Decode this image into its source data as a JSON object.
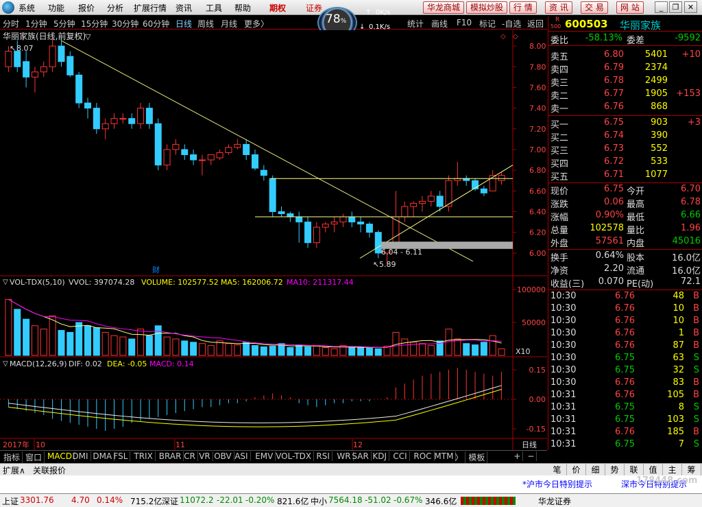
{
  "menu": {
    "items": [
      "系统",
      "功能",
      "报价",
      "分析",
      "扩展行情",
      "资讯",
      "工具",
      "帮助"
    ],
    "period_label": "期权",
    "marquee": "证券",
    "right_buttons": [
      "华龙商城",
      "模拟炒股",
      "行 情",
      "资 讯",
      "交 易",
      "网 站"
    ]
  },
  "speed": {
    "pct": "78",
    "unit": "%",
    "up": "0K/s",
    "down": "0.1K/s"
  },
  "timeframes": [
    "分时",
    "1分钟",
    "5分钟",
    "15分钟",
    "30分钟",
    "60分钟",
    "日线",
    "周线",
    "月线",
    "更多〉"
  ],
  "timeframe_selected": "日线",
  "tools": [
    "统计",
    "画线",
    "F10",
    "标记",
    "-自选",
    "返回"
  ],
  "stock": {
    "title": "华丽家族(日线,前复权)",
    "code": "600503",
    "name": "华丽家族",
    "r_badge": "R",
    "r_sub": "500"
  },
  "main_chart": {
    "high_label": "8.07",
    "low_label": "5.89",
    "range_label": "6.04 - 6.11",
    "event_label": "财",
    "price_ticks": [
      "8.00",
      "7.80",
      "7.60",
      "7.40",
      "7.20",
      "7.00",
      "6.80",
      "6.60",
      "6.40",
      "6.20",
      "6.00"
    ],
    "date_labels": [
      "2017年",
      "10",
      "11",
      "12"
    ],
    "period_label": "日线"
  },
  "vol": {
    "header": "VOL-TDX(5,10)",
    "vvol": "VVOL: 397074.28",
    "volume": "VOLUME: 102577.52",
    "ma5": "MA5: 162006.72",
    "ma10": "MA10: 211317.44",
    "ticks": [
      "100000",
      "50000"
    ],
    "unit": "X10"
  },
  "macd": {
    "header": "MACD(12,26,9)",
    "dif": "DIF: 0.02",
    "dea": "DEA: -0.05",
    "macd": "MACD: 0.14",
    "ticks": [
      "0.15",
      "0.00",
      "-0.15"
    ]
  },
  "quote": {
    "weibi_label": "委比",
    "weibi": "-58.13%",
    "weicha_label": "委差",
    "weicha": "-9592",
    "asks": [
      {
        "label": "卖五",
        "price": "6.80",
        "vol": "5401",
        "chg": "+10"
      },
      {
        "label": "卖四",
        "price": "6.79",
        "vol": "2374",
        "chg": ""
      },
      {
        "label": "卖三",
        "price": "6.78",
        "vol": "2499",
        "chg": ""
      },
      {
        "label": "卖二",
        "price": "6.77",
        "vol": "1905",
        "chg": "+153"
      },
      {
        "label": "卖一",
        "price": "6.76",
        "vol": "868",
        "chg": ""
      }
    ],
    "bids": [
      {
        "label": "买一",
        "price": "6.75",
        "vol": "903",
        "chg": "+3"
      },
      {
        "label": "买二",
        "price": "6.74",
        "vol": "390",
        "chg": ""
      },
      {
        "label": "买三",
        "price": "6.73",
        "vol": "552",
        "chg": ""
      },
      {
        "label": "买四",
        "price": "6.72",
        "vol": "533",
        "chg": ""
      },
      {
        "label": "买五",
        "price": "6.71",
        "vol": "1077",
        "chg": ""
      }
    ],
    "stats": [
      {
        "l1": "现价",
        "v1": "6.75",
        "c1": "red",
        "l2": "今开",
        "v2": "6.70",
        "c2": "red"
      },
      {
        "l1": "涨跌",
        "v1": "0.06",
        "c1": "red",
        "l2": "最高",
        "v2": "6.78",
        "c2": "red"
      },
      {
        "l1": "涨幅",
        "v1": "0.90%",
        "c1": "red",
        "l2": "最低",
        "v2": "6.66",
        "c2": "green"
      },
      {
        "l1": "总量",
        "v1": "102578",
        "c1": "yellow",
        "l2": "量比",
        "v2": "1.96",
        "c2": "red"
      },
      {
        "l1": "外盘",
        "v1": "57561",
        "c1": "red",
        "l2": "内盘",
        "v2": "45016",
        "c2": "green"
      }
    ],
    "stats2": [
      {
        "l1": "换手",
        "v1": "0.64%",
        "l2": "股本",
        "v2": "16.0亿"
      },
      {
        "l1": "净资",
        "v1": "2.20",
        "l2": "流通",
        "v2": "16.0亿"
      },
      {
        "l1": "收益(三)",
        "v1": "0.070",
        "l2": "PE(动)",
        "v2": "72.1"
      }
    ]
  },
  "ticks": [
    {
      "t": "10:30",
      "p": "6.76",
      "v": "48",
      "s": "B"
    },
    {
      "t": "10:30",
      "p": "6.76",
      "v": "10",
      "s": "B"
    },
    {
      "t": "10:30",
      "p": "6.76",
      "v": "10",
      "s": "B"
    },
    {
      "t": "10:30",
      "p": "6.76",
      "v": "1",
      "s": "B"
    },
    {
      "t": "10:30",
      "p": "6.76",
      "v": "87",
      "s": "B"
    },
    {
      "t": "10:30",
      "p": "6.75",
      "v": "63",
      "s": "S"
    },
    {
      "t": "10:30",
      "p": "6.75",
      "v": "32",
      "s": "S"
    },
    {
      "t": "10:30",
      "p": "6.76",
      "v": "83",
      "s": "B"
    },
    {
      "t": "10:31",
      "p": "6.76",
      "v": "105",
      "s": "B"
    },
    {
      "t": "10:31",
      "p": "6.75",
      "v": "8",
      "s": "S"
    },
    {
      "t": "10:31",
      "p": "6.75",
      "v": "103",
      "s": "S"
    },
    {
      "t": "10:31",
      "p": "6.76",
      "v": "185",
      "s": "B"
    },
    {
      "t": "10:31",
      "p": "6.75",
      "v": "7",
      "s": "S"
    }
  ],
  "bottom_tabs": [
    "指标",
    "窗口",
    "MACD",
    "DMI",
    "DMA",
    "FSL",
    "TRIX",
    "BRAR",
    "CR",
    "VR",
    "OBV",
    "ASI",
    "EMV",
    "VOL-TDX",
    "RSI",
    "WR",
    "SAR",
    "KDJ",
    "CCI",
    "ROC",
    "MTM",
    "〉",
    "模板",
    "+",
    "−"
  ],
  "bottom_selected": "MACD",
  "ext": {
    "ext_label": "扩展∧",
    "ref_label": "关联报价",
    "right_tabs": [
      "笔",
      "价",
      "细",
      "势",
      "联",
      "值",
      "主",
      "筹"
    ]
  },
  "news": {
    "left": "*沪市今日特别提示",
    "right": "深市今日特别提示",
    "watermark": "178448.com"
  },
  "status": {
    "sh_label": "上证",
    "sh": "3301.76",
    "sh_chg": "4.70",
    "sh_pct": "0.14%",
    "sh_amt": "715.2亿",
    "sz_label": "深证",
    "sz": "11072.2",
    "sz_chg": "-22.01",
    "sz_pct": "-0.20%",
    "sz_amt": "821.6亿",
    "zx_label": "中小",
    "zx": "7564.18",
    "zx_chg": "-51.02",
    "zx_pct": "-0.67%",
    "zx_amt": "346.6亿",
    "broker": "华龙证券"
  },
  "chart_data": [
    {
      "type": "candlestick",
      "title": "华丽家族(日线,前复权)",
      "ylim": [
        5.8,
        8.1
      ],
      "ohlc": [
        [
          7.8,
          8.0,
          7.75,
          7.95
        ],
        [
          7.95,
          8.05,
          7.75,
          7.8
        ],
        [
          7.85,
          7.95,
          7.6,
          7.7
        ],
        [
          7.7,
          7.8,
          7.55,
          7.75
        ],
        [
          7.75,
          7.85,
          7.7,
          7.8
        ],
        [
          7.8,
          8.07,
          7.75,
          8.0
        ],
        [
          8.0,
          8.07,
          7.8,
          7.85
        ],
        [
          7.9,
          7.95,
          7.7,
          7.72
        ],
        [
          7.72,
          7.75,
          7.4,
          7.45
        ],
        [
          7.45,
          7.5,
          7.3,
          7.4
        ],
        [
          7.4,
          7.45,
          7.15,
          7.2
        ],
        [
          7.2,
          7.3,
          7.1,
          7.25
        ],
        [
          7.25,
          7.35,
          7.2,
          7.3
        ],
        [
          7.3,
          7.35,
          7.25,
          7.3
        ],
        [
          7.3,
          7.35,
          7.2,
          7.25
        ],
        [
          7.25,
          7.45,
          7.2,
          7.4
        ],
        [
          7.4,
          7.45,
          7.2,
          7.25
        ],
        [
          7.25,
          7.3,
          6.8,
          6.85
        ],
        [
          6.85,
          7.05,
          6.8,
          7.0
        ],
        [
          7.0,
          7.1,
          6.95,
          7.05
        ],
        [
          7.0,
          7.05,
          6.9,
          6.95
        ],
        [
          6.95,
          7.0,
          6.85,
          6.9
        ],
        [
          6.9,
          6.95,
          6.75,
          6.9
        ],
        [
          6.9,
          6.95,
          6.85,
          6.95
        ],
        [
          6.92,
          7.0,
          6.9,
          6.97
        ],
        [
          6.97,
          7.05,
          6.95,
          7.02
        ],
        [
          7.02,
          7.1,
          7.0,
          7.05
        ],
        [
          7.05,
          7.1,
          6.9,
          6.95
        ],
        [
          6.95,
          7.0,
          6.8,
          6.82
        ],
        [
          6.8,
          6.85,
          6.7,
          6.75
        ],
        [
          6.72,
          6.75,
          6.35,
          6.4
        ],
        [
          6.4,
          6.45,
          6.35,
          6.38
        ],
        [
          6.38,
          6.4,
          6.3,
          6.35
        ],
        [
          6.35,
          6.4,
          6.1,
          6.3
        ],
        [
          6.3,
          6.35,
          6.05,
          6.1
        ],
        [
          6.1,
          6.3,
          6.05,
          6.25
        ],
        [
          6.25,
          6.3,
          6.2,
          6.28
        ],
        [
          6.28,
          6.35,
          6.2,
          6.3
        ],
        [
          6.3,
          6.38,
          6.25,
          6.35
        ],
        [
          6.35,
          6.4,
          6.25,
          6.3
        ],
        [
          6.3,
          6.35,
          6.2,
          6.28
        ],
        [
          6.28,
          6.3,
          6.15,
          6.2
        ],
        [
          6.2,
          6.22,
          5.95,
          6.0
        ],
        [
          6.0,
          6.1,
          5.89,
          6.08
        ],
        [
          6.1,
          6.6,
          6.05,
          6.35
        ],
        [
          6.35,
          6.5,
          6.3,
          6.45
        ],
        [
          6.45,
          6.5,
          6.35,
          6.48
        ],
        [
          6.48,
          6.55,
          6.4,
          6.5
        ],
        [
          6.5,
          6.6,
          6.45,
          6.55
        ],
        [
          6.55,
          6.6,
          6.4,
          6.45
        ],
        [
          6.45,
          6.75,
          6.4,
          6.7
        ],
        [
          6.7,
          6.88,
          6.65,
          6.72
        ],
        [
          6.72,
          6.75,
          6.65,
          6.7
        ],
        [
          6.7,
          6.72,
          6.6,
          6.62
        ],
        [
          6.62,
          6.65,
          6.55,
          6.58
        ],
        [
          6.6,
          6.8,
          6.6,
          6.75
        ],
        [
          6.7,
          6.78,
          6.66,
          6.75
        ]
      ]
    },
    {
      "type": "bar",
      "title": "VOL-TDX(5,10)",
      "values": [
        85,
        70,
        55,
        45,
        40,
        60,
        38,
        35,
        50,
        45,
        42,
        35,
        30,
        28,
        25,
        40,
        30,
        45,
        28,
        25,
        22,
        20,
        18,
        15,
        22,
        18,
        16,
        20,
        15,
        13,
        14,
        18,
        12,
        15,
        13,
        14,
        12,
        10,
        15,
        12,
        13,
        11,
        10,
        14,
        35,
        25,
        20,
        18,
        15,
        22,
        40,
        25,
        18,
        16,
        20,
        30,
        10
      ]
    },
    {
      "type": "bar",
      "title": "MACD(12,26,9)",
      "values": [
        -0.04,
        -0.05,
        -0.06,
        -0.07,
        -0.08,
        -0.1,
        -0.11,
        -0.12,
        -0.13,
        -0.14,
        -0.15,
        -0.16,
        -0.15,
        -0.14,
        -0.12,
        -0.11,
        -0.1,
        -0.09,
        -0.08,
        -0.07,
        -0.06,
        -0.05,
        -0.04,
        -0.04,
        -0.03,
        -0.02,
        -0.02,
        -0.01,
        0.01,
        0.02,
        0.03,
        0.02,
        0.01,
        -0.02,
        -0.03,
        -0.04,
        -0.03,
        -0.02,
        -0.02,
        -0.01,
        -0.01,
        -0.01,
        0.0,
        0.01,
        0.06,
        0.08,
        0.1,
        0.12,
        0.13,
        0.14,
        0.15,
        0.16,
        0.15,
        0.14,
        0.13,
        0.12,
        0.14
      ]
    }
  ]
}
